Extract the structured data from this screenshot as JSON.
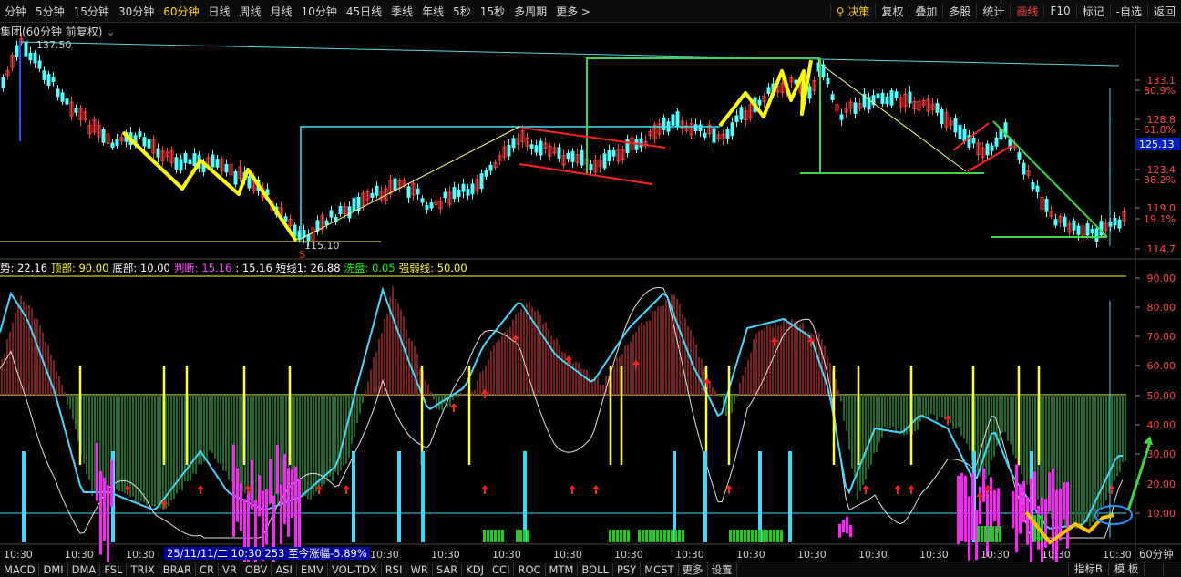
{
  "topbar": {
    "timeframes": [
      "分钟",
      "5分钟",
      "15分钟",
      "30分钟",
      "60分钟",
      "日线",
      "周线",
      "月线",
      "10分钟",
      "45日线",
      "季线",
      "年线",
      "5秒",
      "15秒",
      "多周期",
      "更多 >"
    ],
    "active_index": 4,
    "right_menu": [
      {
        "label": "决策",
        "style": "dec"
      },
      {
        "label": "复权"
      },
      {
        "label": "叠加"
      },
      {
        "label": "多股"
      },
      {
        "label": "统计"
      },
      {
        "label": "画线",
        "style": "hl"
      },
      {
        "label": "F10"
      },
      {
        "label": "标记"
      },
      {
        "label": "-自选"
      },
      {
        "label": "返回"
      }
    ]
  },
  "title": {
    "text": "集团(60分钟 前复权)",
    "arrow": "⌄"
  },
  "price_axis": {
    "labels": [
      "133.1",
      "80.9%",
      "128.8",
      "61.8%",
      "123.4",
      "38.2%",
      "119.0",
      "19.1%",
      "114.7"
    ],
    "current_price": "125.13",
    "high_label": "137.50",
    "low_label": "115.10",
    "marker": "S"
  },
  "indicator": {
    "legend": [
      {
        "text": "势: 22.16",
        "color": "#ffffff"
      },
      {
        "text": "顶部: 90.00",
        "color": "#ffff00"
      },
      {
        "text": "底部: 10.00",
        "color": "#ffffff"
      },
      {
        "text": "判断: 15.16",
        "color": "#ff40ff"
      },
      {
        "text": ": 15.16",
        "color": "#ffffff"
      },
      {
        "text": "短线1: 26.88",
        "color": "#ffffff"
      },
      {
        "text": "洗盘: 0.05",
        "color": "#00ff00"
      },
      {
        "text": "强弱线: 50.00",
        "color": "#ffff00"
      }
    ],
    "axis_labels": [
      "90.00",
      "80.00",
      "70.00",
      "60.00",
      "50.00",
      "40.00",
      "30.00",
      "20.00",
      "10.00"
    ]
  },
  "time_axis": {
    "labels": [
      "10:30",
      "10:30",
      "10:30",
      "10:30",
      "10:30",
      "10:30",
      "10:30",
      "10:30",
      "10:30",
      "10:30",
      "10:30",
      "10:30",
      "10:30",
      "10:30",
      "10:30",
      "10:30",
      "10:30",
      "10:30",
      "10:30"
    ],
    "info": "25/11/11/二 10:30 253 至今涨幅-5.89%",
    "period": "60分钟"
  },
  "bottom_tabs": [
    "MACD",
    "DMI",
    "DMA",
    "FSL",
    "TRIX",
    "BRAR",
    "CR",
    "VR",
    "OBV",
    "ASI",
    "EMV",
    "VOL-TDX",
    "RSI",
    "WR",
    "SAR",
    "KDJ",
    "CCI",
    "ROC",
    "MTM",
    "BOLL",
    "PSY",
    "MCST",
    "更多",
    "设置"
  ],
  "bottom_right": [
    "指标B",
    "模 板",
    "",
    ""
  ],
  "colors": {
    "up": "#ff3c3c",
    "down": "#54ffff",
    "yellow": "#ffff00",
    "green": "#2ecc40",
    "cyan": "#00d8ff",
    "magenta": "#ff22ff",
    "redArrow": "#ff2020"
  }
}
